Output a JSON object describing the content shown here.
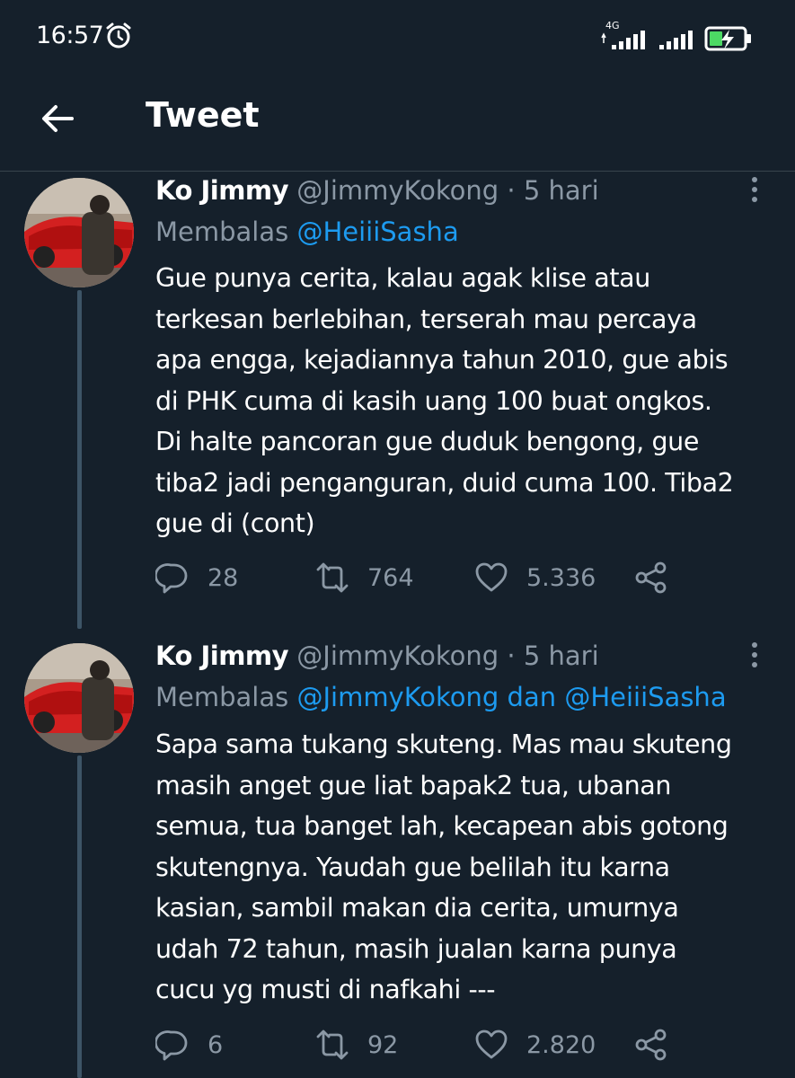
{
  "status_bar": {
    "time": "16:57",
    "network_label": "4G",
    "icons": [
      "alarm-icon",
      "signal-icon",
      "signal-icon",
      "battery-charging-icon"
    ]
  },
  "app_bar": {
    "back_icon": "arrow-left-icon",
    "title": "Tweet"
  },
  "colors": {
    "background": "#15202b",
    "accent": "#1d9bf0",
    "secondary_text": "#8b98a5",
    "divider": "#38444d"
  },
  "tweets": [
    {
      "author": "Ko Jimmy",
      "handle": "@JimmyKokong",
      "time": "· 5 hari",
      "replying_prefix": "Membalas",
      "replying_to": "@HeiiiSasha",
      "text_lines": [
        "Gue punya cerita, kalau agak klise atau",
        "terkesan berlebihan, terserah mau percaya",
        "apa engga, kejadiannya tahun 2010, gue abis",
        "di PHK cuma di kasih uang 100 buat ongkos.",
        "Di halte pancoran gue duduk bengong, gue",
        "tiba2 jadi penganguran, duid cuma 100. Tiba2",
        "gue di (cont)"
      ],
      "replies": "28",
      "retweets": "764",
      "likes": "5.336"
    },
    {
      "author": "Ko Jimmy",
      "handle": "@JimmyKokong",
      "time": "· 5 hari",
      "replying_prefix": "Membalas",
      "replying_to": "@JimmyKokong dan @HeiiiSasha",
      "text_lines": [
        "Sapa sama tukang skuteng. Mas mau skuteng",
        "masih anget gue liat bapak2 tua, ubanan",
        "semua, tua banget lah, kecapean abis gotong",
        "skutengnya. Yaudah gue belilah itu karna",
        "kasian, sambil makan dia cerita, umurnya",
        "udah 72 tahun, masih jualan karna punya",
        "cucu yg musti di nafkahi ---"
      ],
      "replies": "6",
      "retweets": "92",
      "likes": "2.820"
    }
  ]
}
